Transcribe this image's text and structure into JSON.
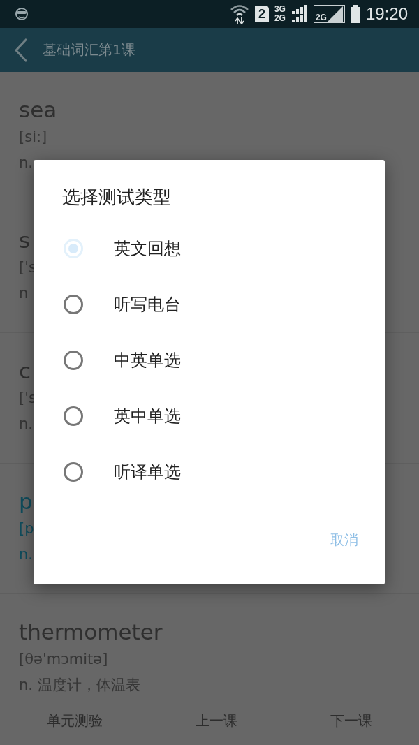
{
  "status_bar": {
    "sim": "2",
    "net_top": "3G",
    "net_bottom": "2G",
    "net_boxed": "2G",
    "time": "19:20"
  },
  "toolbar": {
    "title": "基础词汇第1课"
  },
  "words": [
    {
      "word": "sea",
      "phonetic": "[si:]",
      "meaning": "n.",
      "highlighted": false
    },
    {
      "word": "s",
      "phonetic": "['s",
      "meaning": "n",
      "highlighted": false
    },
    {
      "word": "c",
      "phonetic": "['s",
      "meaning": "n.",
      "highlighted": false
    },
    {
      "word": "p",
      "phonetic": "[p",
      "meaning": "n.",
      "highlighted": true
    },
    {
      "word": "thermometer",
      "phonetic": "[θə'mɔmitə]",
      "meaning": "n. 温度计，体温表",
      "highlighted": false
    }
  ],
  "dialog": {
    "title": "选择测试类型",
    "options": [
      {
        "label": "英文回想",
        "selected": true
      },
      {
        "label": "听写电台",
        "selected": false
      },
      {
        "label": "中英单选",
        "selected": false
      },
      {
        "label": "英中单选",
        "selected": false
      },
      {
        "label": "听译单选",
        "selected": false
      }
    ],
    "cancel": "取消"
  },
  "bottom_bar": [
    "单元测验",
    "上一课",
    "下一课"
  ]
}
